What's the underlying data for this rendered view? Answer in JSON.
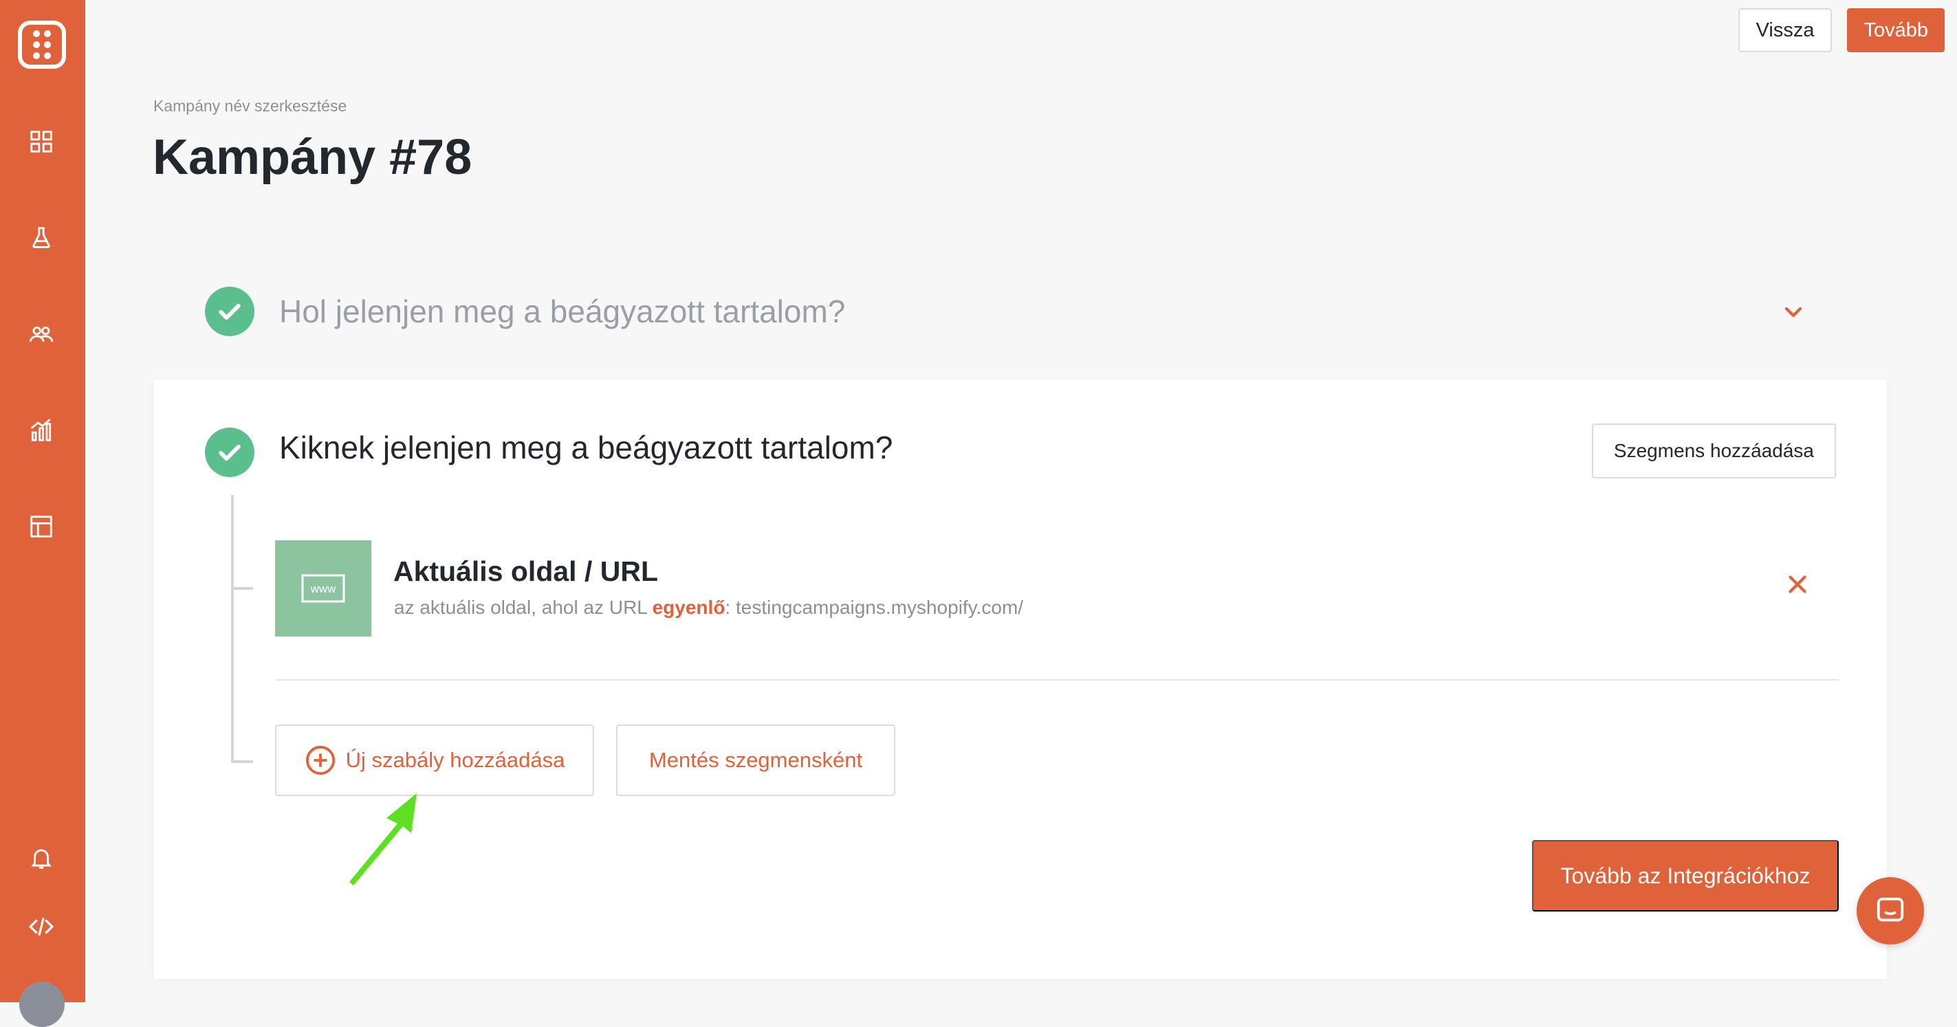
{
  "colors": {
    "accent": "#e0623b",
    "success": "#5bbf8d",
    "rule_icon_bg": "#8dc4a0",
    "annotation_arrow": "#5de01f"
  },
  "sidebar": {
    "icons": [
      "logo-icon",
      "dashboard-icon",
      "experiments-icon",
      "audience-icon",
      "analytics-icon",
      "layout-icon",
      "bell-icon",
      "code-icon"
    ]
  },
  "top_actions": {
    "back_label": "Vissza",
    "next_label": "Tovább"
  },
  "header": {
    "breadcrumb": "Kampány név szerkesztése",
    "title": "Kampány #78"
  },
  "section_where": {
    "title": "Hol jelenjen meg a beágyazott tartalom?"
  },
  "section_who": {
    "title": "Kiknek jelenjen meg a beágyazott tartalom?",
    "add_segment_label": "Szegmens hozzáadása",
    "rule": {
      "icon_text": "www",
      "title": "Aktuális oldal / URL",
      "desc_prefix": "az aktuális oldal, ahol az URL ",
      "desc_operator": "egyenlő",
      "desc_value": ": testingcampaigns.myshopify.com/"
    },
    "add_rule_label": "Új szabály hozzáadása",
    "save_segment_label": "Mentés szegmensként",
    "next_integrations_label": "Tovább az Integrációkhoz"
  }
}
